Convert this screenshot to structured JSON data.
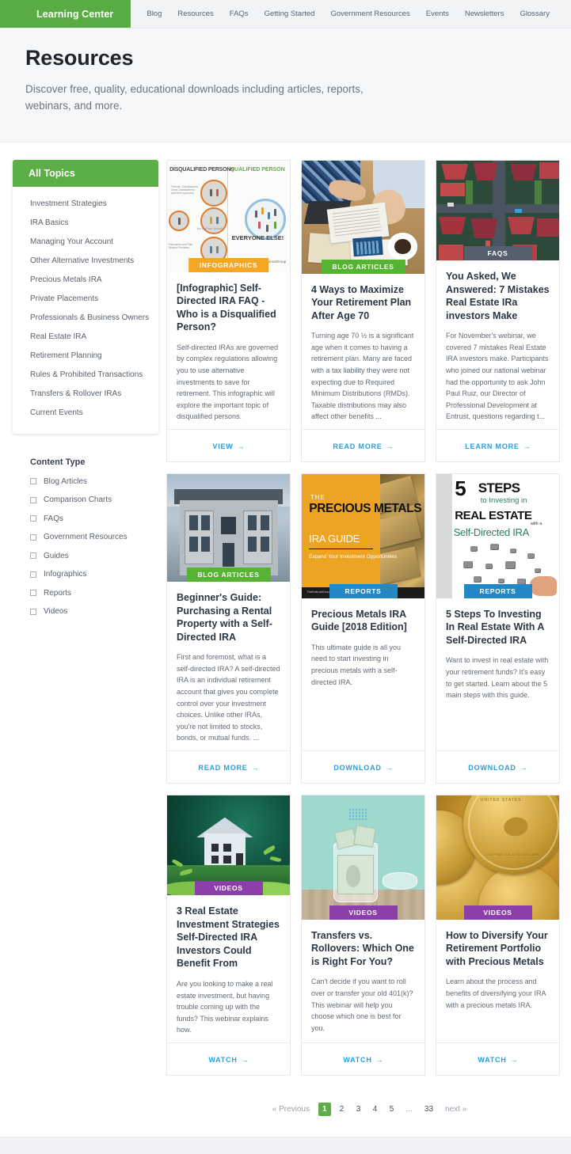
{
  "nav": {
    "brand": "Learning Center",
    "links": [
      "Blog",
      "Resources",
      "FAQs",
      "Getting Started",
      "Government Resources",
      "Events",
      "Newsletters",
      "Glossary"
    ]
  },
  "hero": {
    "title": "Resources",
    "subtitle": "Discover free, quality, educational downloads including articles, reports, webinars, and more."
  },
  "sidebar": {
    "topics_heading": "All Topics",
    "topics": [
      "Investment Strategies",
      "IRA Basics",
      "Managing Your Account",
      "Other Alternative Investments",
      "Precious Metals IRA",
      "Private Placements",
      "Professionals & Business Owners",
      "Real Estate IRA",
      "Retirement Planning",
      "Rules & Prohibited Transactions",
      "Transfers & Rollover IRAs",
      "Current Events"
    ],
    "content_type_heading": "Content Type",
    "content_types": [
      "Blog Articles",
      "Comparison Charts",
      "FAQs",
      "Government Resources",
      "Guides",
      "Infographics",
      "Reports",
      "Videos"
    ]
  },
  "cards": [
    {
      "badge": "INFOGRAPHICS",
      "badge_color": "#f5a623",
      "title": "[Infographic] Self-Directed IRA FAQ - Who is a Disqualified Person?",
      "desc": "Self-directed IRAs are governed by complex regulations allowing you to use alternative investments to save for retirement. This infographic will explore the important topic of disqualified persons.",
      "cta": "VIEW",
      "image_alt": "disqualified-persons-infographic",
      "image_text_left": "DISQUALIFIED PERSONS",
      "image_text_right": "QUALIFIED PERSON",
      "image_text_center": "EVERYONE ELSE!"
    },
    {
      "badge": "BLOG ARTICLES",
      "badge_color": "#56b334",
      "title": "4 Ways to Maximize Your Retirement Plan After Age 70",
      "desc": "Turning age 70 ½ is a significant age when it comes to having a retirement plan. Many are faced with a tax liability they were not expecting due to Required Minimum Distributions (RMDs). Taxable distributions may also affect other benefits ...",
      "cta": "READ MORE",
      "image_alt": "couple-reviewing-paperwork-at-desk"
    },
    {
      "badge": "FAQS",
      "badge_color": "#565f6e",
      "title": "You Asked, We Answered: 7 Mistakes Real Estate IRa investors Make",
      "desc": "For November's webinar, we covered 7 mistakes Real Estate IRA investors make. Participants who joined our national webinar had the opportunity to ask John Paul Ruiz, our Director of Professional Development at Entrust, questions regarding t...",
      "cta": "LEARN MORE",
      "image_alt": "aerial-view-of-suburban-homes"
    },
    {
      "badge": "BLOG ARTICLES",
      "badge_color": "#56b334",
      "title": "Beginner's Guide: Purchasing a Rental Property with a Self-Directed IRA",
      "desc": "First and foremost, what is a self-directed IRA? A self-directed IRA is an individual retirement account that gives you complete control over your investment choices. Unlike other IRAs, you're not limited to stocks, bonds, or mutual funds. ...",
      "cta": "READ MORE",
      "image_alt": "victorian-house-rental-property"
    },
    {
      "badge": "REPORTS",
      "badge_color": "#2289c6",
      "title": "Precious Metals IRA Guide [2018 Edition]",
      "desc": "This ultimate guide is all you need to start investing in precious metals with a self-directed IRA.",
      "cta": "DOWNLOAD",
      "image_alt": "precious-metals-ira-guide-cover",
      "image_text_1": "THE",
      "image_text_2": "PRECIOUS METALS",
      "image_text_3": "IRA GUIDE",
      "image_text_4": "Expand Your Investment Opportunities"
    },
    {
      "badge": "REPORTS",
      "badge_color": "#2289c6",
      "title": "5 Steps To Investing In Real Estate With A Self-Directed IRA",
      "desc": "Want to invest in real estate with your retirement funds? It's easy to get started. Learn about the 5 main steps with this guide.",
      "cta": "DOWNLOAD",
      "image_alt": "5-steps-real-estate-guide-cover",
      "image_text_1": "5",
      "image_text_2": "STEPS",
      "image_text_3": "to Investing in",
      "image_text_4": "REAL ESTATE",
      "image_text_5": "with a",
      "image_text_6": "Self-Directed IRA"
    },
    {
      "badge": "VIDEOS",
      "badge_color": "#8b3fa8",
      "title": "3 Real Estate Investment Strategies Self-Directed IRA Investors Could Benefit From",
      "desc": "Are you looking to make a real estate investment, but having trouble coming up with the funds? This webinar explains how.",
      "cta": "WATCH",
      "image_alt": "model-house-on-green-moss"
    },
    {
      "badge": "VIDEOS",
      "badge_color": "#8b3fa8",
      "title": "Transfers vs. Rollovers: Which One is Right For You?",
      "desc": "Can't decide if you want to roll over or transfer your old 401(k)? This webinar will help you choose which one is best for you.",
      "cta": "WATCH",
      "image_alt": "glass-jar-full-of-money"
    },
    {
      "badge": "VIDEOS",
      "badge_color": "#8b3fa8",
      "title": "How to Diversify Your Retirement Portfolio with Precious Metals",
      "desc": "Learn about the process and benefits of diversifying your IRA with a precious metals IRA.",
      "cta": "WATCH",
      "image_alt": "gold-coins-closeup"
    }
  ],
  "pagination": {
    "previous": "Previous",
    "prev_chevron": "«",
    "pages": [
      "1",
      "2",
      "3",
      "4",
      "5",
      "...",
      "33"
    ],
    "active_page": "1",
    "next": "next",
    "next_chevron": "»"
  },
  "colors": {
    "brand_green": "#59ac44",
    "link_blue": "#2a9fd8",
    "badge_orange": "#f5a623",
    "badge_green": "#56b334",
    "badge_gray": "#565f6e",
    "badge_blue": "#2289c6",
    "badge_purple": "#8b3fa8"
  }
}
